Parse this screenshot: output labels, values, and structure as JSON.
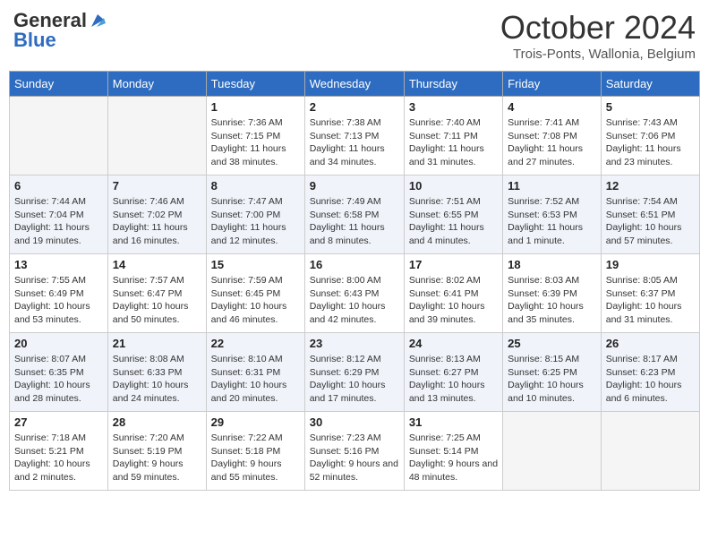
{
  "header": {
    "logo_general": "General",
    "logo_blue": "Blue",
    "month_title": "October 2024",
    "subtitle": "Trois-Ponts, Wallonia, Belgium"
  },
  "days_of_week": [
    "Sunday",
    "Monday",
    "Tuesday",
    "Wednesday",
    "Thursday",
    "Friday",
    "Saturday"
  ],
  "weeks": [
    [
      {
        "day": "",
        "info": ""
      },
      {
        "day": "",
        "info": ""
      },
      {
        "day": "1",
        "info": "Sunrise: 7:36 AM\nSunset: 7:15 PM\nDaylight: 11 hours and 38 minutes."
      },
      {
        "day": "2",
        "info": "Sunrise: 7:38 AM\nSunset: 7:13 PM\nDaylight: 11 hours and 34 minutes."
      },
      {
        "day": "3",
        "info": "Sunrise: 7:40 AM\nSunset: 7:11 PM\nDaylight: 11 hours and 31 minutes."
      },
      {
        "day": "4",
        "info": "Sunrise: 7:41 AM\nSunset: 7:08 PM\nDaylight: 11 hours and 27 minutes."
      },
      {
        "day": "5",
        "info": "Sunrise: 7:43 AM\nSunset: 7:06 PM\nDaylight: 11 hours and 23 minutes."
      }
    ],
    [
      {
        "day": "6",
        "info": "Sunrise: 7:44 AM\nSunset: 7:04 PM\nDaylight: 11 hours and 19 minutes."
      },
      {
        "day": "7",
        "info": "Sunrise: 7:46 AM\nSunset: 7:02 PM\nDaylight: 11 hours and 16 minutes."
      },
      {
        "day": "8",
        "info": "Sunrise: 7:47 AM\nSunset: 7:00 PM\nDaylight: 11 hours and 12 minutes."
      },
      {
        "day": "9",
        "info": "Sunrise: 7:49 AM\nSunset: 6:58 PM\nDaylight: 11 hours and 8 minutes."
      },
      {
        "day": "10",
        "info": "Sunrise: 7:51 AM\nSunset: 6:55 PM\nDaylight: 11 hours and 4 minutes."
      },
      {
        "day": "11",
        "info": "Sunrise: 7:52 AM\nSunset: 6:53 PM\nDaylight: 11 hours and 1 minute."
      },
      {
        "day": "12",
        "info": "Sunrise: 7:54 AM\nSunset: 6:51 PM\nDaylight: 10 hours and 57 minutes."
      }
    ],
    [
      {
        "day": "13",
        "info": "Sunrise: 7:55 AM\nSunset: 6:49 PM\nDaylight: 10 hours and 53 minutes."
      },
      {
        "day": "14",
        "info": "Sunrise: 7:57 AM\nSunset: 6:47 PM\nDaylight: 10 hours and 50 minutes."
      },
      {
        "day": "15",
        "info": "Sunrise: 7:59 AM\nSunset: 6:45 PM\nDaylight: 10 hours and 46 minutes."
      },
      {
        "day": "16",
        "info": "Sunrise: 8:00 AM\nSunset: 6:43 PM\nDaylight: 10 hours and 42 minutes."
      },
      {
        "day": "17",
        "info": "Sunrise: 8:02 AM\nSunset: 6:41 PM\nDaylight: 10 hours and 39 minutes."
      },
      {
        "day": "18",
        "info": "Sunrise: 8:03 AM\nSunset: 6:39 PM\nDaylight: 10 hours and 35 minutes."
      },
      {
        "day": "19",
        "info": "Sunrise: 8:05 AM\nSunset: 6:37 PM\nDaylight: 10 hours and 31 minutes."
      }
    ],
    [
      {
        "day": "20",
        "info": "Sunrise: 8:07 AM\nSunset: 6:35 PM\nDaylight: 10 hours and 28 minutes."
      },
      {
        "day": "21",
        "info": "Sunrise: 8:08 AM\nSunset: 6:33 PM\nDaylight: 10 hours and 24 minutes."
      },
      {
        "day": "22",
        "info": "Sunrise: 8:10 AM\nSunset: 6:31 PM\nDaylight: 10 hours and 20 minutes."
      },
      {
        "day": "23",
        "info": "Sunrise: 8:12 AM\nSunset: 6:29 PM\nDaylight: 10 hours and 17 minutes."
      },
      {
        "day": "24",
        "info": "Sunrise: 8:13 AM\nSunset: 6:27 PM\nDaylight: 10 hours and 13 minutes."
      },
      {
        "day": "25",
        "info": "Sunrise: 8:15 AM\nSunset: 6:25 PM\nDaylight: 10 hours and 10 minutes."
      },
      {
        "day": "26",
        "info": "Sunrise: 8:17 AM\nSunset: 6:23 PM\nDaylight: 10 hours and 6 minutes."
      }
    ],
    [
      {
        "day": "27",
        "info": "Sunrise: 7:18 AM\nSunset: 5:21 PM\nDaylight: 10 hours and 2 minutes."
      },
      {
        "day": "28",
        "info": "Sunrise: 7:20 AM\nSunset: 5:19 PM\nDaylight: 9 hours and 59 minutes."
      },
      {
        "day": "29",
        "info": "Sunrise: 7:22 AM\nSunset: 5:18 PM\nDaylight: 9 hours and 55 minutes."
      },
      {
        "day": "30",
        "info": "Sunrise: 7:23 AM\nSunset: 5:16 PM\nDaylight: 9 hours and 52 minutes."
      },
      {
        "day": "31",
        "info": "Sunrise: 7:25 AM\nSunset: 5:14 PM\nDaylight: 9 hours and 48 minutes."
      },
      {
        "day": "",
        "info": ""
      },
      {
        "day": "",
        "info": ""
      }
    ]
  ]
}
